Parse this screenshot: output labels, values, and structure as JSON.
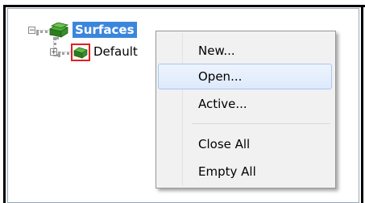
{
  "tree": {
    "root": {
      "label": "Surfaces",
      "expander": "−",
      "icon": "surfaces-folder-icon"
    },
    "child": {
      "label": "Default",
      "expander": "+",
      "icon": "surface-icon"
    }
  },
  "context_menu": {
    "items": [
      {
        "label": "New..."
      },
      {
        "label": "Open...",
        "hovered": true
      },
      {
        "label": "Active..."
      },
      {
        "label": "Close All"
      },
      {
        "label": "Empty All"
      }
    ]
  },
  "colors": {
    "selection": "#3b86dd",
    "menu_bg": "#f1f1f1",
    "hover_border": "#a8c8ef"
  }
}
